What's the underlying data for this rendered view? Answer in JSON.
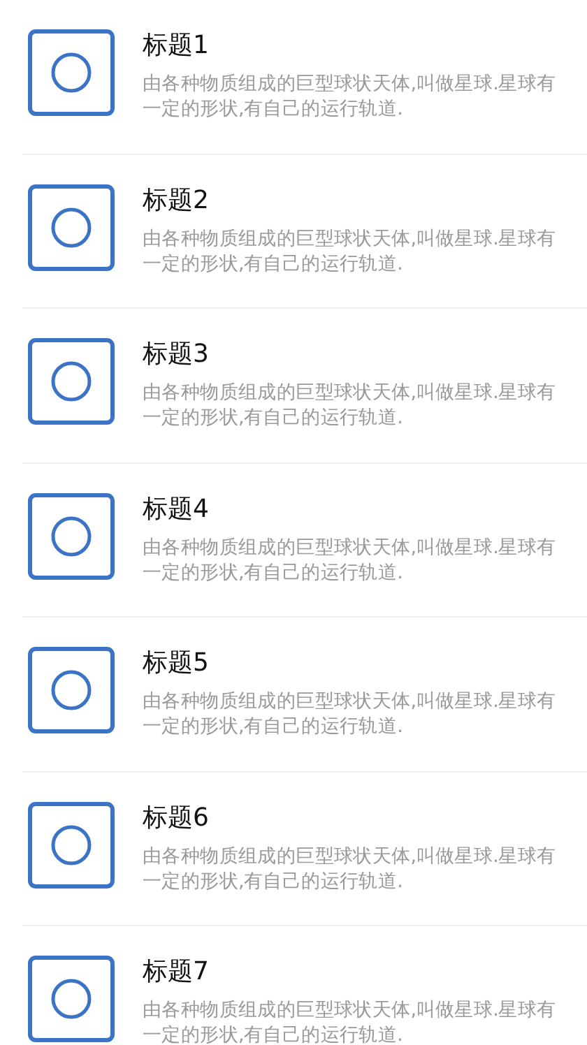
{
  "items": [
    {
      "title": "标题1",
      "description": "由各种物质组成的巨型球状天体,叫做星球.星球有一定的形状,有自己的运行轨道."
    },
    {
      "title": "标题2",
      "description": "由各种物质组成的巨型球状天体,叫做星球.星球有一定的形状,有自己的运行轨道."
    },
    {
      "title": "标题3",
      "description": "由各种物质组成的巨型球状天体,叫做星球.星球有一定的形状,有自己的运行轨道."
    },
    {
      "title": "标题4",
      "description": "由各种物质组成的巨型球状天体,叫做星球.星球有一定的形状,有自己的运行轨道."
    },
    {
      "title": "标题5",
      "description": "由各种物质组成的巨型球状天体,叫做星球.星球有一定的形状,有自己的运行轨道."
    },
    {
      "title": "标题6",
      "description": "由各种物质组成的巨型球状天体,叫做星球.星球有一定的形状,有自己的运行轨道."
    },
    {
      "title": "标题7",
      "description": "由各种物质组成的巨型球状天体,叫做星球.星球有一定的形状,有自己的运行轨道."
    }
  ]
}
